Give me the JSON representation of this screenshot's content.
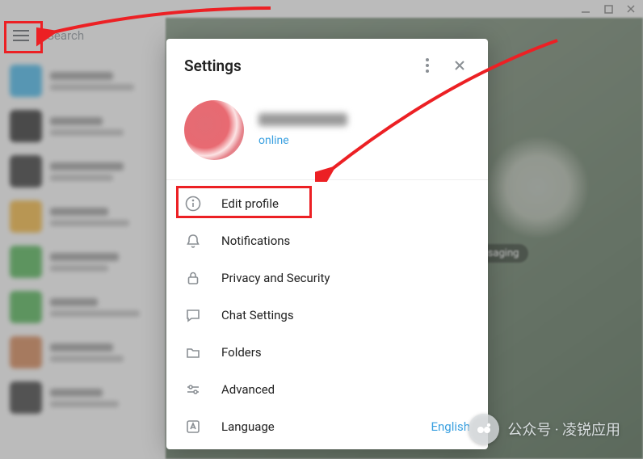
{
  "window": {
    "min": "—",
    "max": "☐",
    "close": "✕"
  },
  "topbar": {
    "search_placeholder": "Search"
  },
  "chatbg": {
    "badge": "ssaging"
  },
  "settings": {
    "title": "Settings",
    "profile": {
      "status": "online"
    },
    "menu": {
      "edit_profile": "Edit profile",
      "notifications": "Notifications",
      "privacy": "Privacy and Security",
      "chat_settings": "Chat Settings",
      "folders": "Folders",
      "advanced": "Advanced",
      "language": "Language",
      "language_value": "English"
    }
  },
  "watermark": {
    "text": "公众号 · 凌锐应用"
  }
}
